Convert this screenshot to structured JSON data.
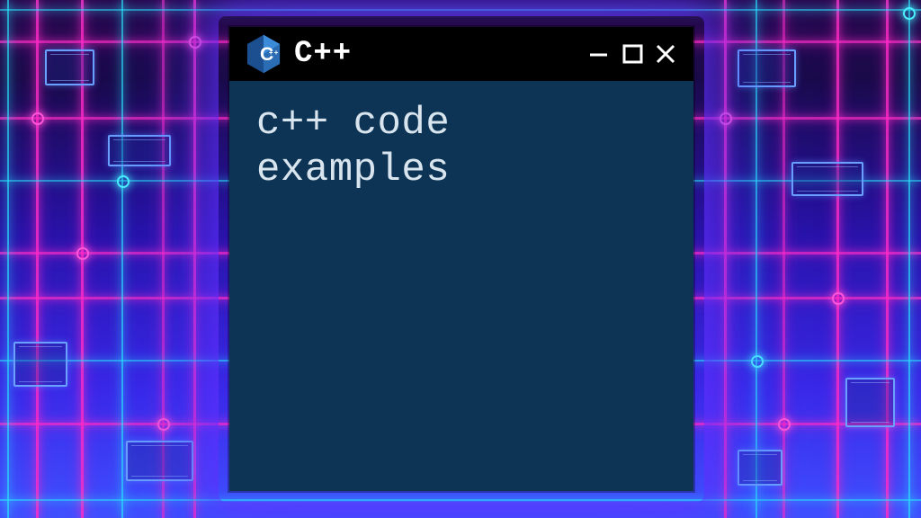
{
  "window": {
    "title": "C++",
    "content_text": "c++ code\nexamples",
    "icon_name": "cpp-logo-icon"
  },
  "controls": {
    "minimize_name": "minimize-button",
    "maximize_name": "maximize-button",
    "close_name": "close-button"
  },
  "colors": {
    "content_bg": "#0d3454",
    "titlebar_bg": "#000000",
    "neon_pink": "#ff2ac8",
    "neon_cyan": "#2ae5ff"
  }
}
